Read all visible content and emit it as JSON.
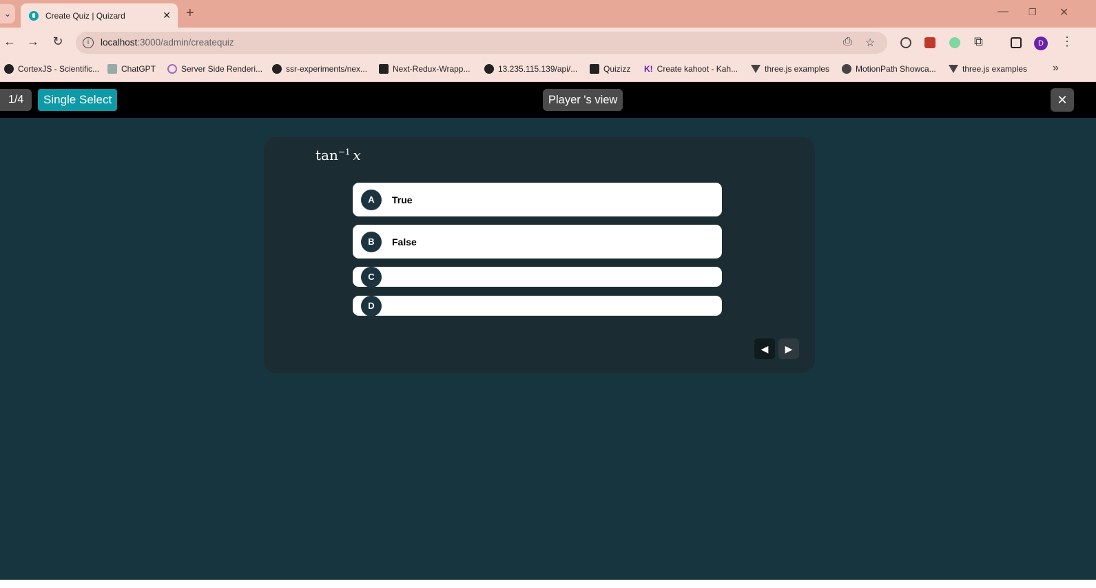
{
  "browser": {
    "tab_title": "Create Quiz | Quizard",
    "url_host": "localhost",
    "url_path": ":3000/admin/createquiz",
    "avatar_letter": "D",
    "bookmarks": [
      "CortexJS - Scientific...",
      "ChatGPT",
      "Server Side Renderi...",
      "ssr-experiments/nex...",
      "Next-Redux-Wrapp...",
      "13.235.115.139/api/...",
      "Quizizz",
      "Create kahoot - Kah...",
      "three.js examples",
      "MotionPath Showca...",
      "three.js examples"
    ]
  },
  "header": {
    "counter": "1/4",
    "question_type": "Single Select",
    "player_view": "Player 's view",
    "close": "✕"
  },
  "question": {
    "func": "tan",
    "sup": "−1",
    "var": "x"
  },
  "options": [
    {
      "letter": "A",
      "text": "True"
    },
    {
      "letter": "B",
      "text": "False"
    },
    {
      "letter": "C",
      "text": ""
    },
    {
      "letter": "D",
      "text": ""
    }
  ],
  "colors": {
    "accent": "#0e9aa7",
    "background": "#17353e",
    "card": "#1b2d32",
    "badge": "#1b3440"
  }
}
